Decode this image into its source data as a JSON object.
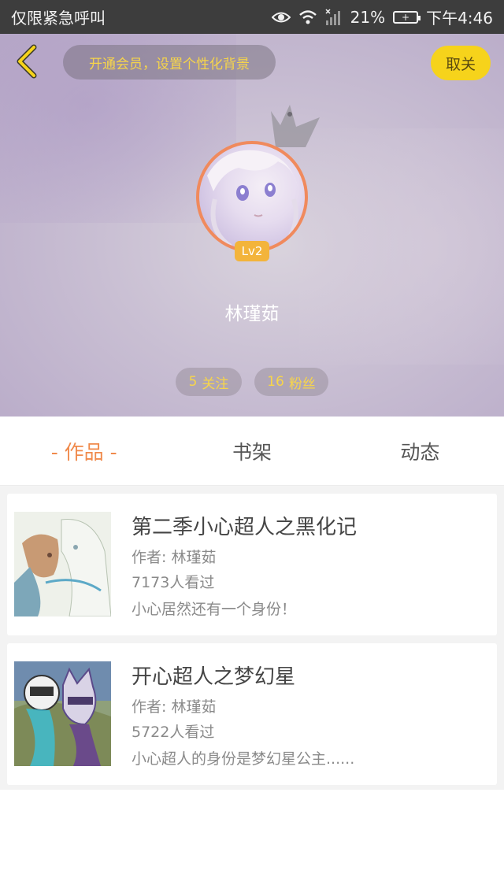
{
  "status_bar": {
    "carrier": "仅限紧急呼叫",
    "battery": "21%",
    "battery_icon_text": "+",
    "time": "下午4:46",
    "icons": [
      "eye-icon",
      "wifi-icon",
      "signal-icon",
      "battery-icon"
    ]
  },
  "header": {
    "vip_banner": "开通会员，设置个性化背景",
    "unfollow_label": "取关",
    "level": "Lv2",
    "username": "林瑾茹",
    "stats": {
      "follow_count": "5",
      "follow_label": "关注",
      "fans_count": "16",
      "fans_label": "粉丝"
    },
    "colors": {
      "accent_yellow": "#f6d31b",
      "avatar_border": "#f08a5d",
      "badge": "#f3b43b"
    }
  },
  "tabs": [
    {
      "label": "- 作品 -",
      "active": true
    },
    {
      "label": "书架",
      "active": false
    },
    {
      "label": "动态",
      "active": false
    }
  ],
  "works": [
    {
      "title": "第二季小心超人之黑化记",
      "author": "作者: 林瑾茹",
      "views": "7173人看过",
      "desc": "小心居然还有一个身份！"
    },
    {
      "title": "开心超人之梦幻星",
      "author": "作者: 林瑾茹",
      "views": "5722人看过",
      "desc": "小心超人的身份是梦幻星公主......"
    }
  ]
}
